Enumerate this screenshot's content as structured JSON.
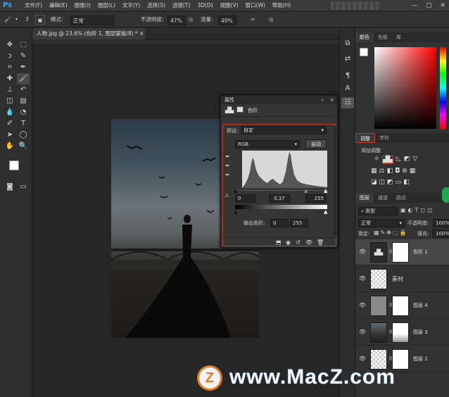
{
  "app": {
    "logo": "Ps"
  },
  "menu": [
    "文件(F)",
    "编辑(E)",
    "图像(I)",
    "图层(L)",
    "文字(Y)",
    "选择(S)",
    "滤镜(T)",
    "3D(D)",
    "视图(V)",
    "窗口(W)",
    "帮助(H)"
  ],
  "options": {
    "brush_size": "3",
    "mode_label": "模式:",
    "mode_value": "正常",
    "opacity_label": "不透明度:",
    "opacity_value": "47%",
    "flow_label": "流量:",
    "flow_value": "49%"
  },
  "document": {
    "tab_title": "人物.jpg @ 23.6% (色阶 1, 图层蒙版/8) *",
    "close": "×"
  },
  "properties": {
    "tab": "属性",
    "sub_title": "色阶",
    "preset_label": "预设:",
    "preset_value": "自定",
    "channel": "RGB",
    "auto_button": "自动",
    "input_black": "0",
    "input_gamma": "0.37",
    "input_white": "255",
    "output_label": "输出色阶:",
    "output_black": "0",
    "output_white": "255"
  },
  "right_panels": {
    "color_tabs": [
      "颜色",
      "色板",
      "库"
    ],
    "adjust_tabs": [
      "调整",
      "字符"
    ],
    "adjust_title": "添加调整",
    "layer_tabs": [
      "图层",
      "通道",
      "路径"
    ],
    "kind_filter": "类型",
    "blend_mode": "正常",
    "opacity_label": "不透明度:",
    "opacity_value": "100%",
    "lock_label": "锁定:",
    "fill_label": "填充:",
    "fill_value": "100%"
  },
  "layers": [
    {
      "name": "色阶 1"
    },
    {
      "name": "素材"
    },
    {
      "name": "图层 4"
    },
    {
      "name": "图层 3"
    },
    {
      "name": "图层 2"
    }
  ],
  "watermark": {
    "text": "www.MacZ.com"
  },
  "colors": {
    "accent_red": "#c0392b",
    "panel_bg": "#323232",
    "watermark_blue": "#1e5fa8"
  }
}
